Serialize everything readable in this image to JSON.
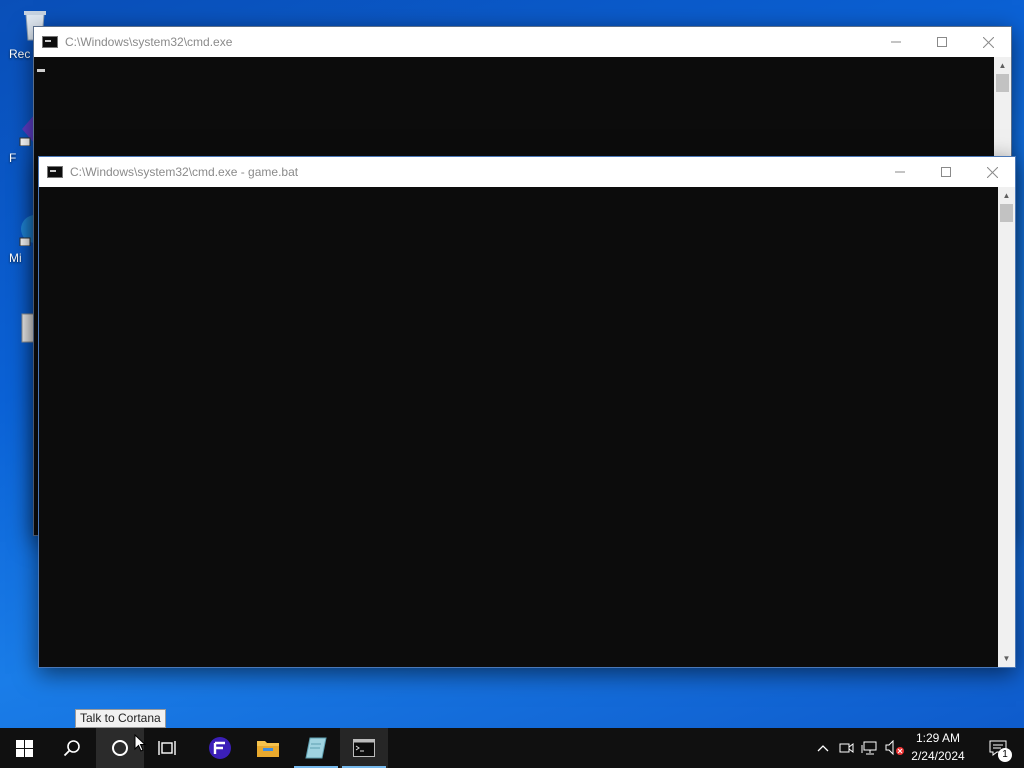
{
  "desktop": {
    "icons": [
      {
        "label": "Rec",
        "icon": "recycle-bin-icon"
      },
      {
        "label": "F",
        "icon": "app-shortcut-icon"
      },
      {
        "label": "Mi",
        "icon": "edge-shortcut-icon"
      },
      {
        "label": "",
        "icon": "file-icon"
      }
    ]
  },
  "windows": [
    {
      "title": "C:\\Windows\\system32\\cmd.exe",
      "state": "background"
    },
    {
      "title": "C:\\Windows\\system32\\cmd.exe - game.bat",
      "state": "foreground"
    }
  ],
  "tooltip": {
    "text": "Talk to Cortana"
  },
  "taskbar": {
    "items": [
      {
        "name": "start",
        "icon": "windows-logo-icon"
      },
      {
        "name": "search",
        "icon": "search-icon"
      },
      {
        "name": "cortana",
        "icon": "cortana-circle-icon"
      },
      {
        "name": "task-view",
        "icon": "task-view-icon"
      },
      {
        "name": "app",
        "icon": "purple-app-icon"
      },
      {
        "name": "file-explorer",
        "icon": "folder-icon"
      },
      {
        "name": "notepad",
        "icon": "notepad-icon"
      },
      {
        "name": "command-prompt",
        "icon": "cmd-icon"
      }
    ],
    "tray": {
      "time": "1:29 AM",
      "date": "2/24/2024",
      "notification_count": "1"
    }
  },
  "colors": {
    "console_bg": "#0c0c0c",
    "taskbar_bg": "#101010",
    "accent": "#76b9ed",
    "desktop": "#0b62d6"
  }
}
